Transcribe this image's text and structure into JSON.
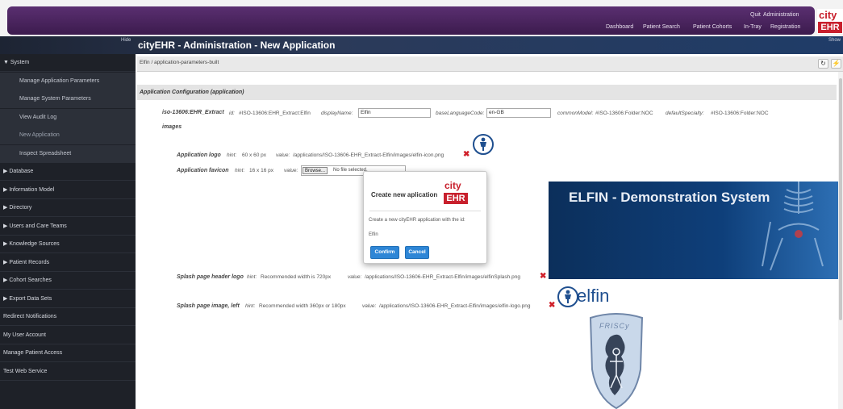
{
  "header": {
    "nav_top": [
      "Quit",
      "Administration"
    ],
    "nav_bottom": [
      "Dashboard",
      "Patient Search",
      "Patient Cohorts",
      "In-Tray",
      "Registration"
    ],
    "logo_city": "city",
    "logo_ehr": "EHR"
  },
  "titlebar": {
    "hide": "Hide",
    "title": "cityEHR - Administration - New Application",
    "show": "Show"
  },
  "sidebar": {
    "items": [
      {
        "label": "▼ System",
        "sub": false
      },
      {
        "label": "Manage Application Parameters",
        "sub": true
      },
      {
        "label": "Manage System Parameters",
        "sub": true
      },
      {
        "label": "View Audit Log",
        "sub": true
      },
      {
        "label": "New Application",
        "sub": true
      },
      {
        "label": "Inspect Spreadsheet",
        "sub": true
      },
      {
        "label": "▶ Database",
        "sub": false
      },
      {
        "label": "▶ Information Model",
        "sub": false
      },
      {
        "label": "▶ Directory",
        "sub": false
      },
      {
        "label": "▶ Users and Care Teams",
        "sub": false
      },
      {
        "label": "▶ Knowledge Sources",
        "sub": false
      },
      {
        "label": "▶ Patient Records",
        "sub": false
      },
      {
        "label": "▶ Cohort Searches",
        "sub": false
      },
      {
        "label": "▶ Export Data Sets",
        "sub": false
      },
      {
        "label": "Redirect Notifications",
        "sub": false
      },
      {
        "label": "My User Account",
        "sub": false
      },
      {
        "label": "Manage Patient Access",
        "sub": false
      },
      {
        "label": "Test Web Service",
        "sub": false
      }
    ]
  },
  "main": {
    "breadcrumb": "Elfin / application-parameters-built",
    "toolbar_icons": [
      "refresh-icon",
      "lightning-icon"
    ],
    "section_title": "Application Configuration (application)",
    "extract": {
      "name": "iso-13606:EHR_Extract",
      "id_label": "id:",
      "id_value": "#ISO-13606:EHR_Extract:Elfin",
      "display_label": "displayName:",
      "display_value": "Elfin",
      "lang_label": "baseLanguageCode:",
      "lang_value": "en-GB",
      "model_label": "commonModel:",
      "model_value": "#ISO-13606:Folder:NOC",
      "specialty_label": "defaultSpecialty:",
      "specialty_value": "#ISO-13606:Folder:NOC"
    },
    "images_label": "images",
    "logo_row": {
      "label": "Application logo",
      "hint_label": "hint:",
      "hint": "60 x 60 px",
      "value_label": "value:",
      "value": "/applications/ISO-13606-EHR_Extract-Elfin/images/elfin-icon.png"
    },
    "favicon_row": {
      "label": "Application favicon",
      "hint_label": "hint:",
      "hint": "16 x 16 px",
      "value_label": "value:",
      "browse": "Browse...",
      "file_status": "No file selected."
    },
    "splash_header_row": {
      "label": "Splash page header logo",
      "hint_label": "hint:",
      "hint": "Recommended width is 720px",
      "value_label": "value:",
      "value": "/applications/ISO-13606-EHR_Extract-Elfin/images/elfinSplash.png"
    },
    "splash_image_row": {
      "label": "Splash page image, left",
      "hint_label": "hint:",
      "hint": "Recommended width 360px or 180px",
      "value_label": "value:",
      "value": "/applications/ISO-13606-EHR_Extract-Elfin/images/elfin-logo.png"
    },
    "splash_banner_title": "ELFIN - Demonstration System",
    "elfin_logo_text": "elfin",
    "friscy_text": "FRISCy"
  },
  "dialog": {
    "title": "Create new aplication",
    "message": "Create a new cityEHR application with the id:",
    "app_id": "Elfin",
    "confirm": "Confirm",
    "cancel": "Cancel"
  },
  "colors": {
    "header_purple": "#4a2560",
    "sidebar_bg": "#1e2128",
    "brand_red": "#c8202d",
    "button_blue": "#2e86d6",
    "delete_red": "#d0202a"
  }
}
